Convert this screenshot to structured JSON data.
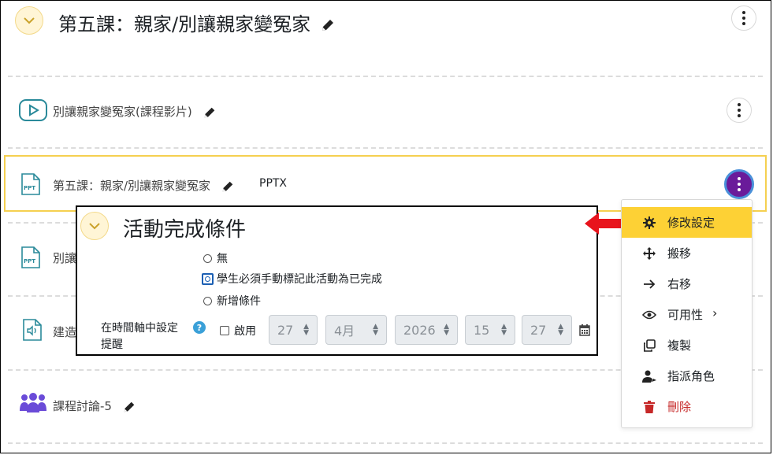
{
  "section": {
    "title": "第五課：親家/別讓親家變冤家"
  },
  "activities": [
    {
      "name": "別讓親家變冤家(課程影片)",
      "icon": "video-icon"
    },
    {
      "name": "第五課：親家/別讓親家變冤家",
      "icon": "ppt-file-icon",
      "badge": "PPTX"
    },
    {
      "name": "別讓",
      "icon": "ppt-file-icon"
    },
    {
      "name": "建造",
      "icon": "audio-file-icon"
    },
    {
      "name": "課程討論-5",
      "icon": "forum-icon"
    }
  ],
  "completion_popup": {
    "title": "活動完成條件",
    "options": [
      {
        "label": "無",
        "selected": false
      },
      {
        "label": "學生必須手動標記此活動為已完成",
        "selected": true
      },
      {
        "label": "新增條件",
        "selected": false
      }
    ],
    "reminder_label": "在時間軸中設定提醒",
    "help": "?",
    "enable_label": "啟用",
    "date": {
      "day": "27",
      "month": "4月",
      "year": "2026",
      "hour": "15",
      "minute": "27"
    }
  },
  "action_menu": {
    "items": [
      {
        "label": "修改設定",
        "icon": "gear-icon",
        "highlight": true
      },
      {
        "label": "搬移",
        "icon": "move-icon"
      },
      {
        "label": "右移",
        "icon": "arrow-right-icon"
      },
      {
        "label": "可用性",
        "icon": "eye-icon",
        "submenu": true
      },
      {
        "label": "複製",
        "icon": "duplicate-icon"
      },
      {
        "label": "指派角色",
        "icon": "assign-role-icon"
      },
      {
        "label": "刪除",
        "icon": "trash-icon",
        "danger": true
      }
    ]
  },
  "colors": {
    "accent_yellow": "#fdd135",
    "active_purple": "#6a1b9a",
    "danger": "#c62828",
    "teal": "#2a8a9a",
    "forum_purple": "#6a4bd8",
    "red_arrow": "#e8141c"
  }
}
